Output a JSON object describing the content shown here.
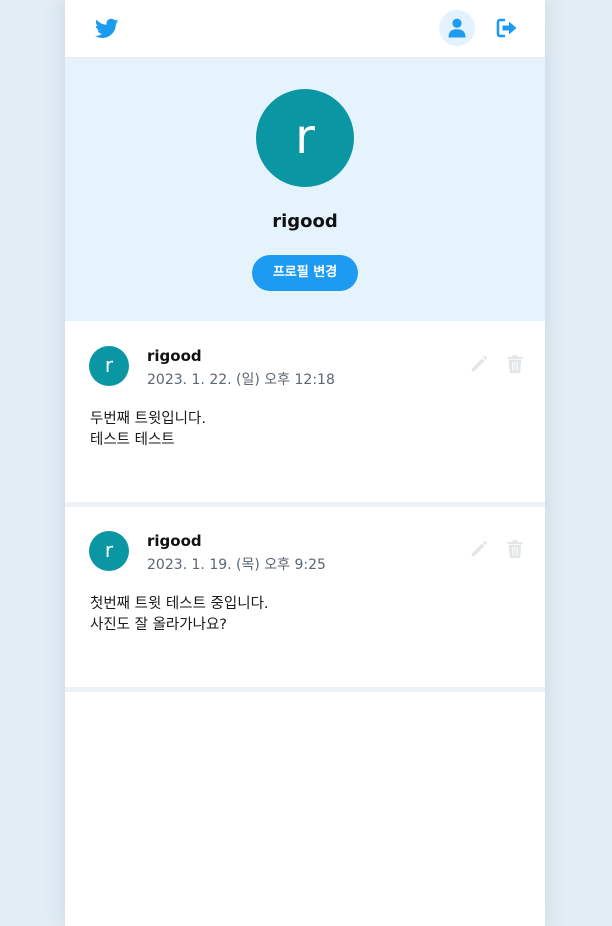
{
  "topbar": {
    "logo_icon": "twitter-bird-icon",
    "profile_icon": "user-icon",
    "logout_icon": "sign-out-icon",
    "accent": "#1d9bf0"
  },
  "profile": {
    "avatar_letter": "r",
    "name": "rigood",
    "edit_label": "프로필 변경",
    "avatar_color": "#0a97a3"
  },
  "tweets": [
    {
      "avatar_letter": "r",
      "name": "rigood",
      "date": "2023. 1. 22. (일) 오후 12:18",
      "lines": [
        "두번째 트윗입니다.",
        "테스트 테스트"
      ]
    },
    {
      "avatar_letter": "r",
      "name": "rigood",
      "date": "2023. 1. 19. (목) 오후 9:25",
      "lines": [
        "첫번째 트윗 테스트 중입니다.",
        "사진도 잘 올라가나요?"
      ]
    }
  ]
}
